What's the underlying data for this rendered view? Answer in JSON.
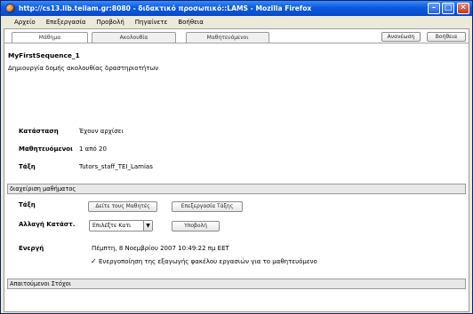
{
  "window": {
    "title": "http://cs13.lib.teilam.gr:8080 - διδακτικό προσωπικό::LAMS - Mozilla Firefox",
    "minimize_label": "–",
    "maximize_label": "□",
    "close_label": "✕"
  },
  "menu": {
    "items": [
      "Αρχείο",
      "Επεξεργασία",
      "Προβολή",
      "Πηγαίνετε",
      "Βοήθεια"
    ]
  },
  "tabs": {
    "lesson": "Μάθημα",
    "sequence": "Ακολουθία",
    "learners": "Μαθητευόμενοι"
  },
  "toolbar": {
    "refresh_label": "Ανανέωση",
    "help_label": "Βοήθεια"
  },
  "sequence": {
    "name": "MyFirstSequence_1",
    "description": "Δημιουργία δομής ακολουθίας δραστηριοτήτων"
  },
  "details": {
    "status_label": "Κατάσταση",
    "status_value": "Έχουν αρχίσει",
    "learners_label": "Μαθητευόμενοι",
    "learners_value": "1 από 20",
    "class_label": "Τάξη",
    "class_value": "Tutors_staff_TEI_Lamias"
  },
  "management": {
    "section_title": "διαχείριση μαθήματος",
    "class_label": "Τάξη",
    "view_learners_button": "Δείτε τους Μαθητές",
    "edit_class_button": "Επεξεργασία Τάξης",
    "change_status_label": "Αλλαγή Κατάστ.",
    "status_select_value": "Επιλέξτε Κατι",
    "submit_button": "Υποβολή",
    "active_label": "Ενεργή",
    "active_value": "Πέμπτη, 8 Νοεμβρίου 2007 10:49:22 πμ EET",
    "export_checkbox_label": "Ενεργοποίηση της εξαγωγής φακέλου εργασιών για το μαθητευόμενο",
    "export_checked": true
  },
  "goals": {
    "section_title": "Απαιτούμενοι Στόχοι"
  },
  "colors": {
    "titlebar": "#0a5ae0",
    "section_bar": "#e8e8e8",
    "window_frame": "#ece9d8"
  }
}
